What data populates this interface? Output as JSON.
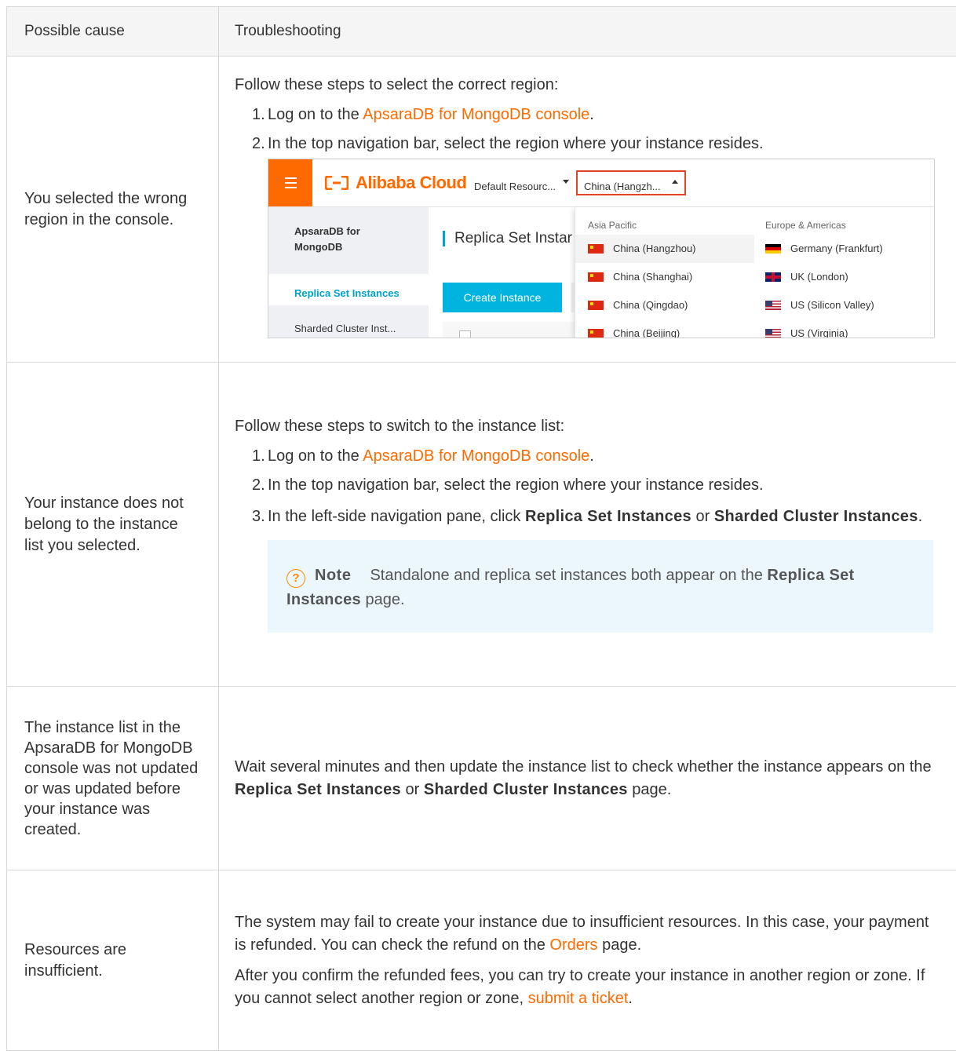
{
  "table": {
    "headers": [
      "Possible cause",
      "Troubleshooting"
    ],
    "rows": [
      {
        "cause": "You selected the wrong region in the console.",
        "intro": "Follow these steps to select the correct region:",
        "steps": [
          {
            "num": "1.",
            "pre": "Log on to the ",
            "link": "ApsaraDB for MongoDB console",
            "post": "."
          },
          {
            "num": "2.",
            "text": "In the top navigation bar, select the region where your instance resides."
          }
        ]
      },
      {
        "cause": "Your instance does not belong to the instance list you selected.",
        "intro": "Follow these steps to switch to the instance list:",
        "steps": [
          {
            "num": "1.",
            "pre": "Log on to the ",
            "link": "ApsaraDB for MongoDB console",
            "post": "."
          },
          {
            "num": "2.",
            "text": "In the top navigation bar, select the region where your instance resides."
          },
          {
            "num": "3.",
            "pre": "In the left-side navigation pane, click ",
            "bold1": "Replica Set Instances",
            "mid": " or ",
            "bold2": "Sharded Cluster Instances",
            "post": "."
          }
        ],
        "note": {
          "icon": "?",
          "label": "Note",
          "text": "Standalone and replica set instances both appear on the ",
          "bold": "Replica Set Instances",
          "post": " page."
        }
      },
      {
        "cause": "The instance list in the ApsaraDB for MongoDB console was not updated or was updated before your instance was created.",
        "text_pre": "Wait several minutes and then update the instance list to check whether the instance appears on the ",
        "bold1": "Replica Set Instances",
        "mid": " or ",
        "bold2": "Sharded Cluster Instances",
        "post": " page."
      },
      {
        "cause": "Resources are insufficient.",
        "p1_pre": "The system may fail to create your instance due to insufficient resources. In this case, your payment is refunded. You can check the refund on the ",
        "p1_link": "Orders",
        "p1_post": " page.",
        "p2_pre": "After you confirm the refunded fees, you can try to create your instance in another region or zone. If you cannot select another region or zone, ",
        "p2_link": "submit a ticket",
        "p2_post": "."
      }
    ]
  },
  "screenshot": {
    "logo_text": "Alibaba Cloud",
    "resource_group": "Default Resourc...",
    "region_selected": "China (Hangzh...",
    "sidebar": {
      "title": "ApsaraDB for MongoDB",
      "selected": "Replica Set Instances",
      "item": "Sharded Cluster Inst..."
    },
    "page_title": "Replica Set Instar",
    "create_button": "Create Instance",
    "dropdown": {
      "group1": "Asia Pacific",
      "group2": "Europe & Americas",
      "col1": [
        "China (Hangzhou)",
        "China (Shanghai)",
        "China (Qingdao)",
        "China (Beijing)"
      ],
      "col2": [
        "Germany (Frankfurt)",
        "UK (London)",
        "US (Silicon Valley)",
        "US (Virginia)"
      ]
    }
  },
  "colors": {
    "link": "#ff6a00",
    "brand": "#ff6a00",
    "highlight_box": "#e3432b",
    "console_accent": "#00a2ca",
    "note_background": "#ecf7fd"
  }
}
